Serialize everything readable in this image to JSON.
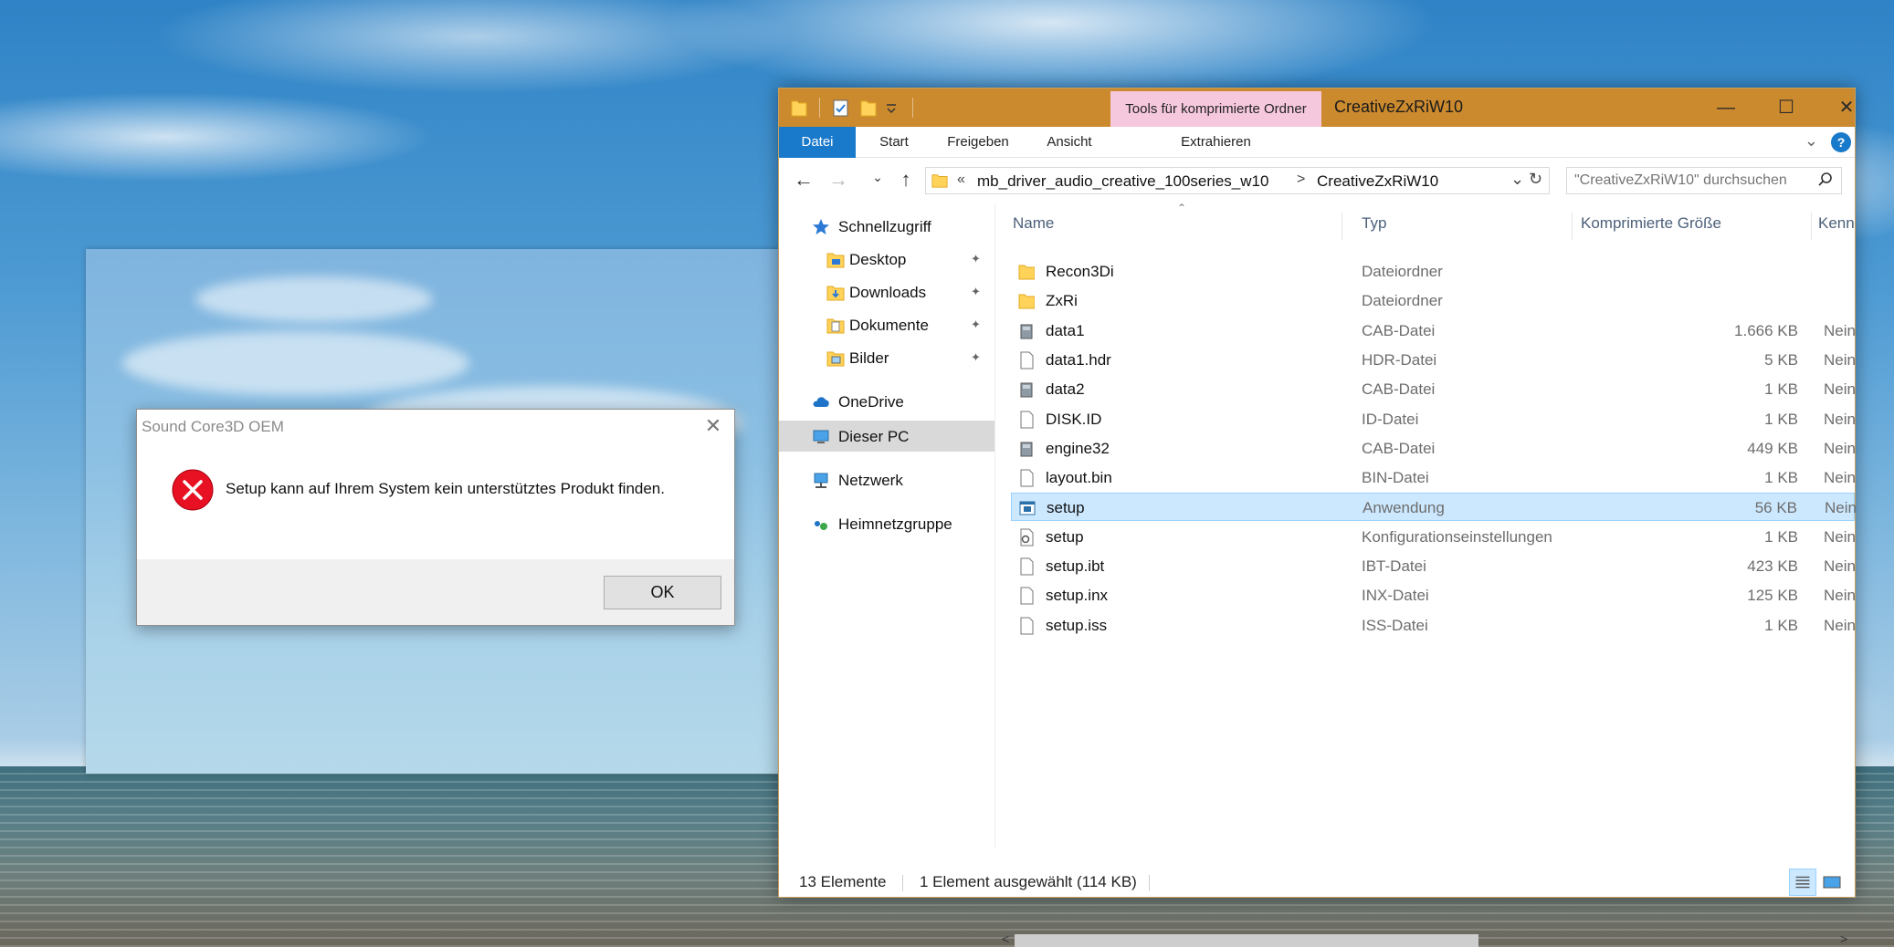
{
  "dialog": {
    "title": "Sound Core3D OEM",
    "message": "Setup kann auf Ihrem System kein unterstütztes Produkt finden.",
    "ok_label": "OK",
    "close_symbol": "✕"
  },
  "explorer": {
    "window_title": "CreativeZxRiW10",
    "tools_tab": "Tools für komprimierte Ordner",
    "window_buttons": {
      "minimize": "—",
      "maximize": "☐",
      "close": "✕"
    },
    "ribbon_tabs": [
      "Datei",
      "Start",
      "Freigeben",
      "Ansicht",
      "Extrahieren"
    ],
    "address": {
      "overflow": "«",
      "crumbs": [
        "mb_driver_audio_creative_100series_w10",
        "CreativeZxRiW10"
      ],
      "separator": ">"
    },
    "search_placeholder": "\"CreativeZxRiW10\" durchsuchen",
    "nav_buttons": {
      "back": "←",
      "forward": "→",
      "recent": "⌄",
      "up": "↑",
      "refresh": "↻",
      "dropdown": "⌄"
    },
    "nav_pane": [
      {
        "label": "Schnellzugriff",
        "icon": "star-icon"
      },
      {
        "label": "Desktop",
        "icon": "desktop-folder-icon",
        "pinned": true
      },
      {
        "label": "Downloads",
        "icon": "downloads-folder-icon",
        "pinned": true
      },
      {
        "label": "Dokumente",
        "icon": "documents-folder-icon",
        "pinned": true
      },
      {
        "label": "Bilder",
        "icon": "pictures-folder-icon",
        "pinned": true
      },
      {
        "label": "OneDrive",
        "icon": "cloud-icon"
      },
      {
        "label": "Dieser PC",
        "icon": "computer-icon",
        "selected": true
      },
      {
        "label": "Netzwerk",
        "icon": "network-icon"
      },
      {
        "label": "Heimnetzgruppe",
        "icon": "homegroup-icon"
      }
    ],
    "pin_symbol": "📌",
    "columns": [
      "Name",
      "Typ",
      "Komprimierte Größe",
      "Kenn"
    ],
    "files": [
      {
        "name": "Recon3Di",
        "type": "Dateiordner",
        "size": "",
        "kenn": "",
        "icon": "folder-icon"
      },
      {
        "name": "ZxRi",
        "type": "Dateiordner",
        "size": "",
        "kenn": "",
        "icon": "folder-icon"
      },
      {
        "name": "data1",
        "type": "CAB-Datei",
        "size": "1.666 KB",
        "kenn": "Nein",
        "icon": "cab-icon"
      },
      {
        "name": "data1.hdr",
        "type": "HDR-Datei",
        "size": "5 KB",
        "kenn": "Nein",
        "icon": "file-icon"
      },
      {
        "name": "data2",
        "type": "CAB-Datei",
        "size": "1 KB",
        "kenn": "Nein",
        "icon": "cab-icon"
      },
      {
        "name": "DISK.ID",
        "type": "ID-Datei",
        "size": "1 KB",
        "kenn": "Nein",
        "icon": "file-icon"
      },
      {
        "name": "engine32",
        "type": "CAB-Datei",
        "size": "449 KB",
        "kenn": "Nein",
        "icon": "cab-icon"
      },
      {
        "name": "layout.bin",
        "type": "BIN-Datei",
        "size": "1 KB",
        "kenn": "Nein",
        "icon": "file-icon"
      },
      {
        "name": "setup",
        "type": "Anwendung",
        "size": "56 KB",
        "kenn": "Nein",
        "icon": "application-icon",
        "selected": true
      },
      {
        "name": "setup",
        "type": "Konfigurationseinstellungen",
        "size": "1 KB",
        "kenn": "Nein",
        "icon": "settings-file-icon"
      },
      {
        "name": "setup.ibt",
        "type": "IBT-Datei",
        "size": "423 KB",
        "kenn": "Nein",
        "icon": "file-icon"
      },
      {
        "name": "setup.inx",
        "type": "INX-Datei",
        "size": "125 KB",
        "kenn": "Nein",
        "icon": "file-icon"
      },
      {
        "name": "setup.iss",
        "type": "ISS-Datei",
        "size": "1 KB",
        "kenn": "Nein",
        "icon": "file-icon"
      }
    ],
    "status": {
      "count": "13 Elemente",
      "selection": "1 Element ausgewählt (114 KB)"
    },
    "colors": {
      "titlebar": "#cc8a2e",
      "tools_tab": "#f6c8dd",
      "file_tab": "#1979ca",
      "selection": "#cce8ff"
    }
  }
}
